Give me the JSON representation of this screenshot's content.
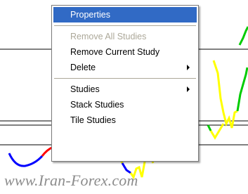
{
  "context_menu": {
    "items": [
      {
        "label": "Properties",
        "state": "selected",
        "submenu": false
      },
      {
        "label": "Remove All Studies",
        "state": "disabled",
        "submenu": false
      },
      {
        "label": "Remove Current Study",
        "state": "normal",
        "submenu": false
      },
      {
        "label": "Delete",
        "state": "normal",
        "submenu": true
      },
      {
        "label": "Studies",
        "state": "normal",
        "submenu": true
      },
      {
        "label": "Stack Studies",
        "state": "normal",
        "submenu": false
      },
      {
        "label": "Tile Studies",
        "state": "normal",
        "submenu": false
      }
    ]
  },
  "watermark": {
    "text": "www.Iran-Forex.com"
  },
  "colors": {
    "selection": "#316ac5",
    "disabled_text": "#aca899",
    "series_blue": "#0000ff",
    "series_red": "#ff0000",
    "series_yellow": "#ffff00",
    "series_green": "#00cc00",
    "watermark": "#8c8c8c"
  }
}
